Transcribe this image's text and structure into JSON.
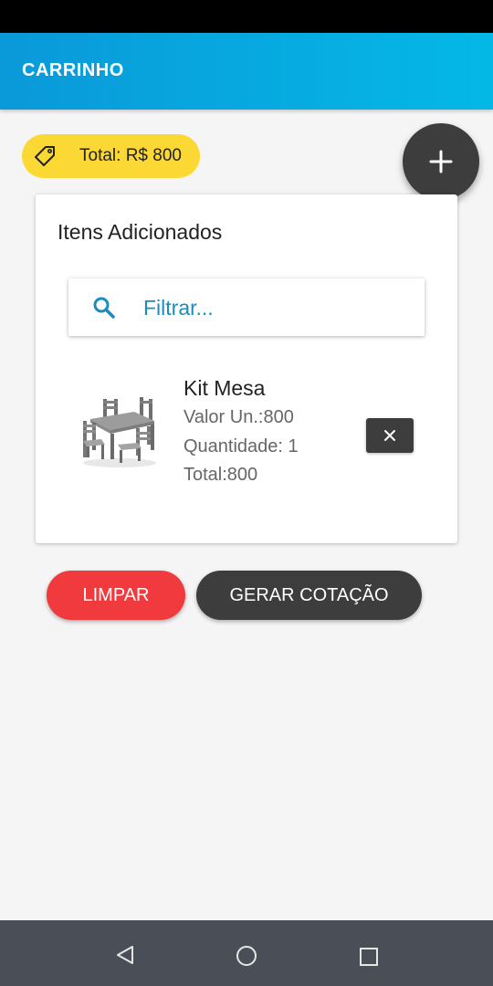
{
  "app_bar": {
    "title": "CARRINHO"
  },
  "total_chip": {
    "text": "Total: R$ 800",
    "icon": "price-tag-icon",
    "color": "#fcd834"
  },
  "fab": {
    "icon": "plus-icon"
  },
  "card": {
    "title": "Itens Adicionados",
    "filter": {
      "placeholder": "Filtrar...",
      "value": "",
      "icon": "search-icon"
    },
    "items": [
      {
        "name": "Kit Mesa",
        "unit_price": "Valor Un.:800",
        "quantity": "Quantidade: 1",
        "total": "Total:800",
        "image": "table-set-image",
        "remove_icon": "close-icon"
      }
    ]
  },
  "actions": {
    "clear_label": "LIMPAR",
    "quote_label": "GERAR COTAÇÃO"
  },
  "colors": {
    "accent": "#04b8e6",
    "danger": "#f03a3e",
    "dark": "#3d3d3d"
  },
  "system_nav": {
    "back": "back-icon",
    "home": "home-icon",
    "recents": "recents-icon"
  }
}
